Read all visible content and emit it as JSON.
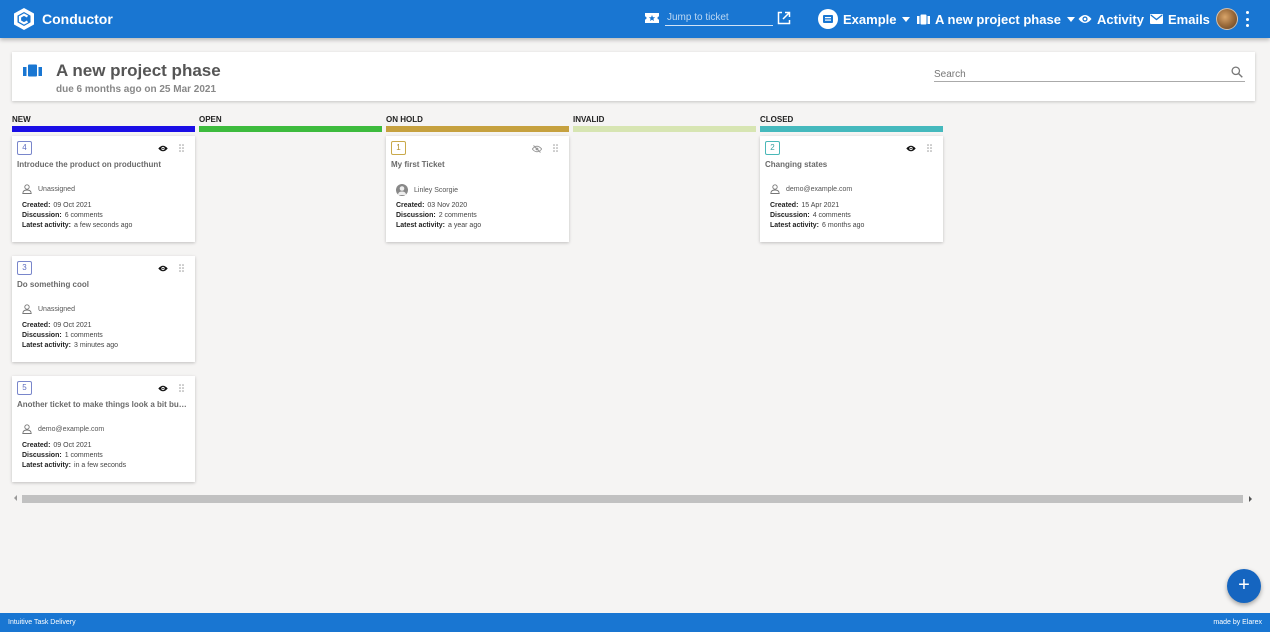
{
  "app": {
    "title": "Conductor"
  },
  "topbar": {
    "jump_placeholder": "Jump to ticket",
    "project_label": "Example",
    "phase_label": "A new project phase",
    "activity_label": "Activity",
    "emails_label": "Emails"
  },
  "phase": {
    "title": "A new project phase",
    "due": "due 6 months ago on 25 Mar 2021",
    "search_placeholder": "Search"
  },
  "columns": [
    {
      "title": "NEW",
      "color": "#1a0ee6"
    },
    {
      "title": "OPEN",
      "color": "#3dbb3d"
    },
    {
      "title": "ON HOLD",
      "color": "#c6a13f"
    },
    {
      "title": "INVALID",
      "color": "#d7e5b2"
    },
    {
      "title": "CLOSED",
      "color": "#45b9bd"
    }
  ],
  "labels": {
    "created": "Created:",
    "discussion": "Discussion:",
    "latest": "Latest activity:"
  },
  "tickets": [
    {
      "id": "4",
      "title": "Introduce the product on producthunt",
      "assignee": "Unassigned",
      "created": "09 Oct 2021",
      "discussion": "6 comments",
      "latest": "a few seconds ago",
      "watched": true
    },
    {
      "id": "3",
      "title": "Do something cool",
      "assignee": "Unassigned",
      "created": "09 Oct 2021",
      "discussion": "1 comments",
      "latest": "3 minutes ago",
      "watched": true
    },
    {
      "id": "5",
      "title": "Another ticket to make things look a bit busi...",
      "assignee": "demo@example.com",
      "created": "09 Oct 2021",
      "discussion": "1 comments",
      "latest": "in a few seconds",
      "watched": true
    },
    {
      "id": "1",
      "title": "My first Ticket",
      "assignee": "Linley Scorgie",
      "created": "03 Nov 2020",
      "discussion": "2 comments",
      "latest": "a year ago",
      "watched": false
    },
    {
      "id": "2",
      "title": "Changing states",
      "assignee": "demo@example.com",
      "created": "15 Apr 2021",
      "discussion": "4 comments",
      "latest": "6 months ago",
      "watched": true
    }
  ],
  "fab": {
    "label": "+"
  },
  "footer": {
    "left": "Intuitive Task Delivery",
    "right": "made by Elarex"
  }
}
